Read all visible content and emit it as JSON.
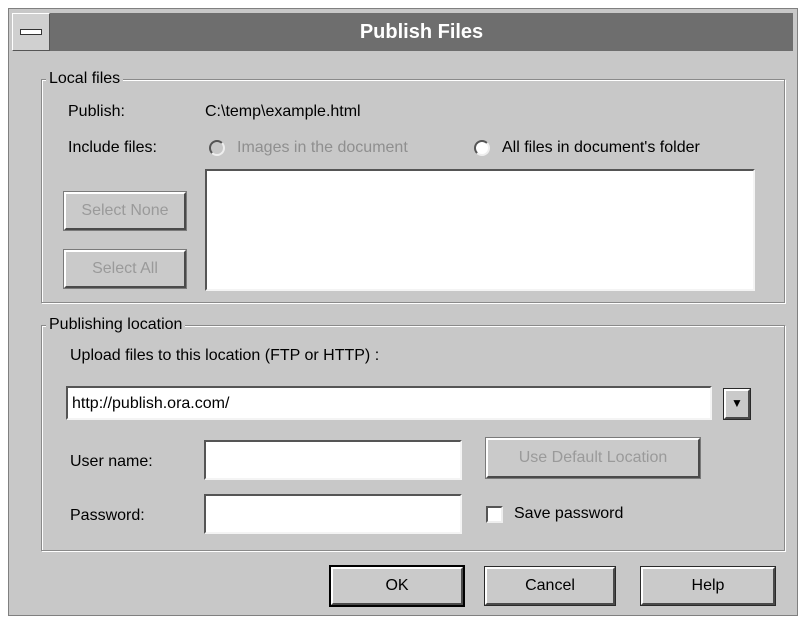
{
  "window": {
    "title": "Publish Files"
  },
  "local_files": {
    "legend": "Local files",
    "publish_label": "Publish:",
    "publish_value": "C:\\temp\\example.html",
    "include_label": "Include files:",
    "radio_images": "Images in the document",
    "radio_all": "All files in document's folder",
    "select_none_label": "Select None",
    "select_all_label": "Select All"
  },
  "publishing_location": {
    "legend": "Publishing location",
    "upload_label": "Upload files to this location (FTP or HTTP) :",
    "url_value": "http://publish.ora.com/",
    "username_label": "User name:",
    "username_value": "",
    "password_label": "Password:",
    "password_value": "",
    "use_default_label": "Use Default Location",
    "save_password_label": "Save password",
    "save_password_checked": false
  },
  "buttons": {
    "ok": "OK",
    "cancel": "Cancel",
    "help": "Help"
  },
  "icons": {
    "system_menu": "system-menu-icon",
    "dropdown": "dropdown-arrow-icon"
  }
}
